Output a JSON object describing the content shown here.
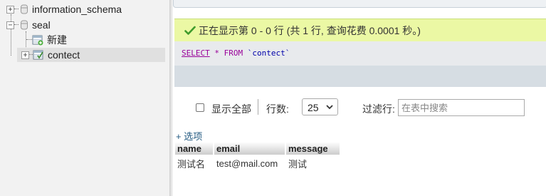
{
  "nav": {
    "items": [
      {
        "label": "information_schema",
        "expander": "+"
      },
      {
        "label": "seal",
        "expander": "−"
      },
      {
        "label": "新建"
      },
      {
        "label": "contect",
        "expander": "+"
      }
    ]
  },
  "message": {
    "text": "正在显示第 0 - 0 行 (共 1 行, 查询花费 0.0001 秒。)",
    "icon": "check-icon",
    "color": "#ebf8a4"
  },
  "sql": {
    "select": "SELECT",
    "star": "*",
    "from": "FROM",
    "table": "`contect`"
  },
  "controls": {
    "show_all_label": "显示全部",
    "rows_label": "行数:",
    "rows_value": "25",
    "filter_label": "过滤行:",
    "filter_placeholder": "在表中搜索"
  },
  "results": {
    "options_link": "+ 选项",
    "columns": [
      "name",
      "email",
      "message"
    ],
    "rows": [
      [
        "测试名",
        "test@mail.com",
        "测试"
      ]
    ]
  }
}
